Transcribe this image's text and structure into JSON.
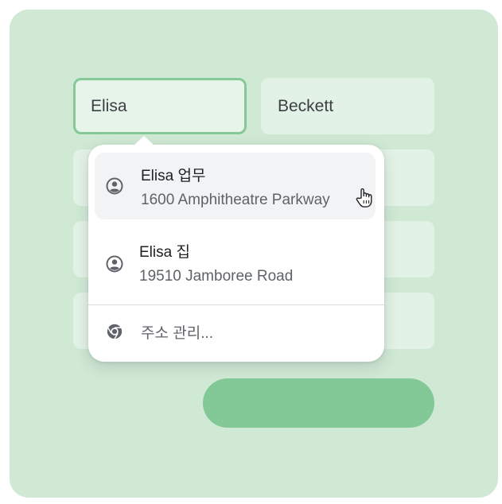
{
  "form": {
    "first_name_value": "Elisa",
    "last_name_value": "Beckett"
  },
  "autofill": {
    "suggestions": [
      {
        "name": "Elisa",
        "label": "업무",
        "address": "1600 Amphitheatre Parkway",
        "icon": "account-circle-icon",
        "highlighted": true
      },
      {
        "name": "Elisa",
        "label": "집",
        "address": "19510 Jamboree Road",
        "icon": "account-circle-icon",
        "highlighted": false
      }
    ],
    "manage_label": "주소 관리...",
    "manage_icon": "chrome-icon"
  },
  "colors": {
    "background": "#cfe9d5",
    "field": "#e3f2e6",
    "focus_border": "#86c996",
    "button": "#83c897",
    "highlight": "#f1f3f4"
  }
}
